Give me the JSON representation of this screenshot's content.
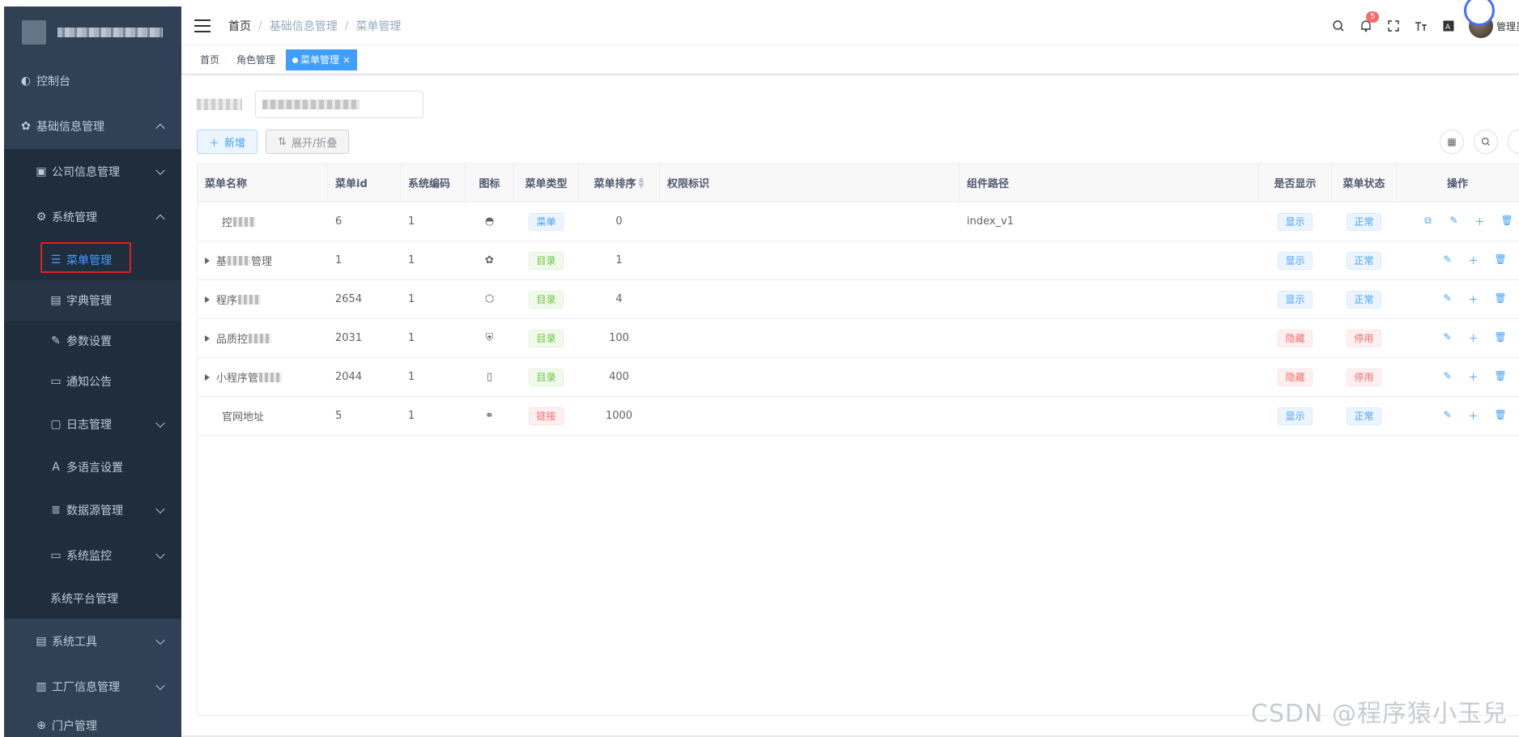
{
  "sidebar": {
    "items": [
      {
        "label": "控制台",
        "icon": "dashboard-icon"
      },
      {
        "label": "基础信息管理",
        "icon": "gear-icon"
      },
      {
        "label": "公司信息管理",
        "icon": "building-icon"
      },
      {
        "label": "系统管理",
        "icon": "settings-circle-icon"
      },
      {
        "label": "菜单管理",
        "icon": "list-icon"
      },
      {
        "label": "字典管理",
        "icon": "dictionary-icon"
      },
      {
        "label": "参数设置",
        "icon": "edit-icon"
      },
      {
        "label": "通知公告",
        "icon": "message-icon"
      },
      {
        "label": "日志管理",
        "icon": "log-icon"
      },
      {
        "label": "多语言设置",
        "icon": "language-icon"
      },
      {
        "label": "数据源管理",
        "icon": "database-icon"
      },
      {
        "label": "系统监控",
        "icon": "monitor-icon"
      },
      {
        "label": "系统平台管理",
        "icon": ""
      },
      {
        "label": "系统工具",
        "icon": "toolbox-icon"
      },
      {
        "label": "工厂信息管理",
        "icon": "factory-icon"
      },
      {
        "label": "门户管理",
        "icon": "globe-icon"
      }
    ]
  },
  "navbar": {
    "breadcrumb": [
      "首页",
      "基础信息管理",
      "菜单管理"
    ],
    "separator": "/",
    "notification_count": "5",
    "user_name": "管理员"
  },
  "tags": {
    "items": [
      "首页",
      "角色管理"
    ],
    "active": "菜单管理",
    "close": "×"
  },
  "toolbar": {
    "add_label": "新增",
    "add_prefix": "＋",
    "expand_label": "展开/折叠",
    "expand_prefix": "⇅"
  },
  "table": {
    "headers": {
      "name": "菜单名称",
      "id": "菜单id",
      "code": "系统编码",
      "icon": "图标",
      "type": "菜单类型",
      "sort": "菜单排序",
      "perm": "权限标识",
      "path": "组件路径",
      "visible": "是否显示",
      "status": "菜单状态",
      "ops": "操作"
    },
    "rows": [
      {
        "name": "控",
        "id": "6",
        "code": "1",
        "icon": "dashboard-icon",
        "type": "菜单",
        "sort": "0",
        "path": "index_v1",
        "visible": "显示",
        "status": "正常"
      },
      {
        "name_pre": "基",
        "name_post": "管理",
        "id": "1",
        "code": "1",
        "icon": "gear-icon",
        "type": "目录",
        "sort": "1",
        "path": "",
        "visible": "显示",
        "status": "正常"
      },
      {
        "name_pre": "程序",
        "name_post": "",
        "id": "2654",
        "code": "1",
        "icon": "cube-icon",
        "type": "目录",
        "sort": "4",
        "path": "",
        "visible": "显示",
        "status": "正常"
      },
      {
        "name_pre": "品质控",
        "name_post": "",
        "id": "2031",
        "code": "1",
        "icon": "shield-icon",
        "type": "目录",
        "sort": "100",
        "path": "",
        "visible": "隐藏",
        "status": "停用"
      },
      {
        "name_pre": "小程序管",
        "name_post": "",
        "id": "2044",
        "code": "1",
        "icon": "phone-icon",
        "type": "目录",
        "sort": "400",
        "path": "",
        "visible": "隐藏",
        "status": "停用"
      },
      {
        "name": "官网地址",
        "id": "5",
        "code": "1",
        "icon": "link-icon",
        "type": "链接",
        "sort": "1000",
        "path": "",
        "visible": "显示",
        "status": "正常"
      }
    ]
  },
  "watermark": "CSDN @程序猿小玉兒",
  "colors": {
    "sidebar_bg": "#304156",
    "primary": "#409eff",
    "success": "#67c23a",
    "danger": "#f56c6c"
  }
}
